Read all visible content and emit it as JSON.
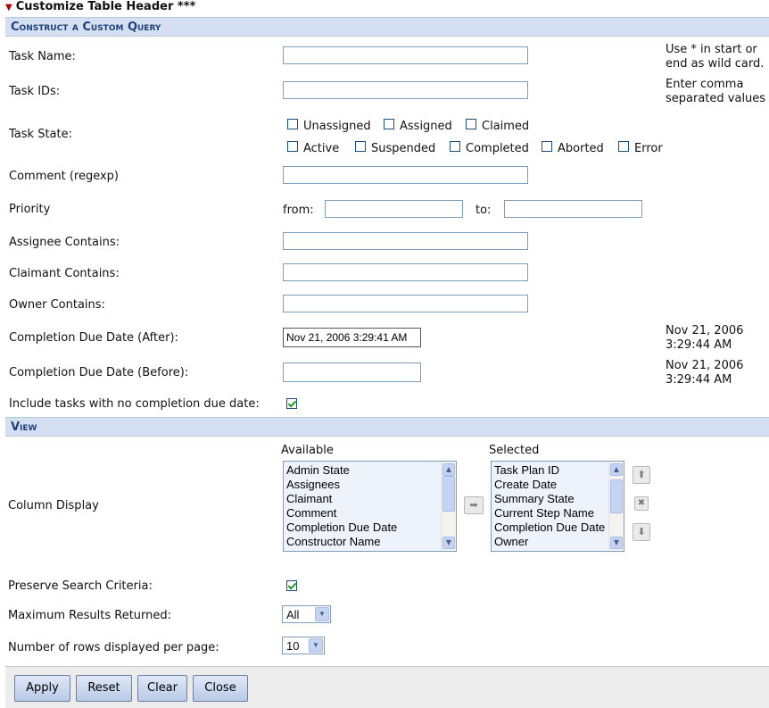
{
  "header": {
    "title": "Customize Table Header ***"
  },
  "sections": {
    "query": "Construct a Custom Query",
    "view": "View"
  },
  "query": {
    "task_name": {
      "label": "Task Name:",
      "value": "",
      "hint": [
        "Use * in start or",
        "end as wild card."
      ]
    },
    "task_ids": {
      "label": "Task IDs:",
      "value": "",
      "hint": [
        "Enter comma",
        "separated values"
      ]
    },
    "task_state": {
      "label": "Task State:",
      "options": [
        {
          "label": "Unassigned",
          "checked": false
        },
        {
          "label": "Assigned",
          "checked": false
        },
        {
          "label": "Claimed",
          "checked": false
        },
        {
          "label": "Active",
          "checked": false
        },
        {
          "label": "Suspended",
          "checked": false
        },
        {
          "label": "Completed",
          "checked": false
        },
        {
          "label": "Aborted",
          "checked": false
        },
        {
          "label": "Error",
          "checked": false
        }
      ]
    },
    "comment": {
      "label": "Comment (regexp)",
      "value": ""
    },
    "priority": {
      "label": "Priority",
      "from_label": "from:",
      "to_label": "to:",
      "from_value": "",
      "to_value": ""
    },
    "assignee": {
      "label": "Assignee Contains:",
      "value": ""
    },
    "claimant": {
      "label": "Claimant Contains:",
      "value": ""
    },
    "owner": {
      "label": "Owner Contains:",
      "value": ""
    },
    "due_after": {
      "label": "Completion Due Date (After):",
      "value": "Nov 21, 2006 3:29:41 AM",
      "hint": [
        "Nov 21, 2006",
        "3:29:44 AM"
      ]
    },
    "due_before": {
      "label": "Completion Due Date (Before):",
      "value": "",
      "hint": [
        "Nov 21, 2006",
        "3:29:44 AM"
      ]
    },
    "include_no_due": {
      "label": "Include tasks with no completion due date:",
      "checked": true
    }
  },
  "view": {
    "column_display_label": "Column Display",
    "available_label": "Available",
    "selected_label": "Selected",
    "available": [
      "Admin State",
      "Assignees",
      "Claimant",
      "Comment",
      "Completion Due Date",
      "Constructor Name"
    ],
    "selected": [
      "Task Plan ID",
      "Create Date",
      "Summary State",
      "Current Step Name",
      "Completion Due Date",
      "Owner"
    ],
    "preserve": {
      "label": "Preserve Search Criteria:",
      "checked": true
    },
    "max_results": {
      "label": "Maximum Results Returned:",
      "value": "All"
    },
    "rows_per_page": {
      "label": "Number of rows displayed per page:",
      "value": "10"
    }
  },
  "buttons": {
    "apply": "Apply",
    "reset": "Reset",
    "clear": "Clear",
    "close": "Close"
  },
  "icons": {
    "move_right": "arrow-right-icon",
    "move_up": "arrow-up-icon",
    "remove": "remove-icon",
    "move_down": "arrow-down-icon"
  }
}
